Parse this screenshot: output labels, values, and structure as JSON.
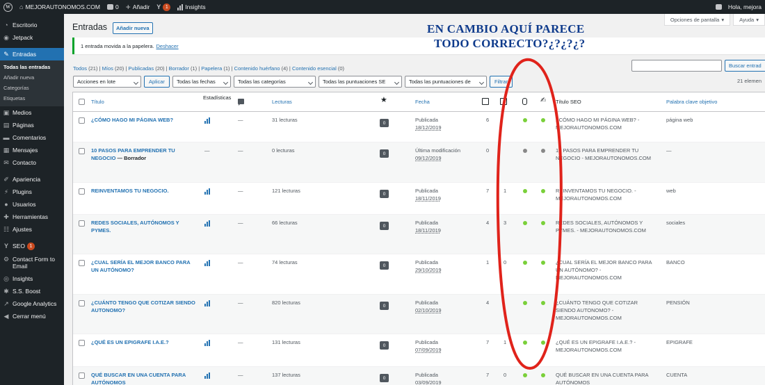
{
  "adminbar": {
    "site_name": "MEJORAUTONOMOS.COM",
    "comments_count": "0",
    "add_new": "Añadir",
    "updates_count": "1",
    "insights": "Insights",
    "greeting": "Hola, mejora"
  },
  "sidebar": {
    "items": [
      {
        "label": "Escritorio",
        "icon": "dashboard-icon"
      },
      {
        "label": "Jetpack",
        "icon": "jetpack-icon"
      },
      {
        "label": "Entradas",
        "icon": "pin-icon"
      },
      {
        "label": "Medios",
        "icon": "media-icon"
      },
      {
        "label": "Páginas",
        "icon": "pages-icon"
      },
      {
        "label": "Comentarios",
        "icon": "comments-icon"
      },
      {
        "label": "Mensajes",
        "icon": "messages-icon"
      },
      {
        "label": "Contacto",
        "icon": "mail-icon"
      },
      {
        "label": "Apariencia",
        "icon": "brush-icon"
      },
      {
        "label": "Plugins",
        "icon": "plugin-icon"
      },
      {
        "label": "Usuarios",
        "icon": "users-icon"
      },
      {
        "label": "Herramientas",
        "icon": "tools-icon"
      },
      {
        "label": "Ajustes",
        "icon": "settings-icon"
      },
      {
        "label": "SEO",
        "icon": "yoast-icon",
        "badge": "1"
      },
      {
        "label": "Contact Form to Email",
        "icon": "gear-icon"
      },
      {
        "label": "Insights",
        "icon": "insights-icon"
      },
      {
        "label": "S.S. Boost",
        "icon": "boost-icon"
      },
      {
        "label": "Google Analytics",
        "icon": "analytics-icon"
      },
      {
        "label": "Cerrar menú",
        "icon": "collapse-icon"
      }
    ],
    "submenu": [
      "Todas las entradas",
      "Añadir nueva",
      "Categorías",
      "Etiquetas"
    ]
  },
  "header": {
    "title": "Entradas",
    "add_new": "Añadir nueva",
    "screen_options": "Opciones de pantalla",
    "help": "Ayuda"
  },
  "notice": {
    "text": "1 entrada movida a la papelera.",
    "undo": "Deshacer"
  },
  "views": [
    {
      "label": "Todos",
      "count": "(21)"
    },
    {
      "label": "Míos",
      "count": "(20)"
    },
    {
      "label": "Publicadas",
      "count": "(20)"
    },
    {
      "label": "Borrador",
      "count": "(1)"
    },
    {
      "label": "Papelera",
      "count": "(1)"
    },
    {
      "label": "Contenido huérfano",
      "count": "(4)"
    },
    {
      "label": "Contenido esencial",
      "count": "(0)"
    }
  ],
  "search": {
    "button": "Buscar entrad"
  },
  "filters": {
    "bulk": "Acciones en lote",
    "apply": "Aplicar",
    "dates": "Todas las fechas",
    "categories": "Todas las categorías",
    "seo_scores": "Todas las puntuaciones SE",
    "readability": "Todas las puntuaciones de",
    "filter": "Filtrar",
    "items_count": "21 elemen"
  },
  "columns": {
    "title": "Título",
    "stats": "Estadísticas",
    "reads": "Lecturas",
    "date": "Fecha",
    "seo_title": "Título SEO",
    "focus_kw": "Palabra clave objetivo"
  },
  "rows": [
    {
      "title": "¿CÓMO HAGO MI PÁGINA WEB?",
      "suffix": "",
      "stats": true,
      "comments": "—",
      "reads": "31 lecturas",
      "score": "0",
      "status": "Publicada",
      "date": "18/12/2019",
      "links_out": "6",
      "links_in": "",
      "seo": "green",
      "read": "green",
      "seo_title": "¿CÓMO HAGO MI PÁGINA WEB? - MEJORAUTONOMOS.COM",
      "kw": "página web"
    },
    {
      "title": "10 PASOS PARA EMPRENDER TU NEGOCIO",
      "suffix": " — Borrador",
      "stats": false,
      "comments": "—",
      "reads": "0 lecturas",
      "score": "0",
      "status": "Última modificación",
      "date": "09/12/2019",
      "links_out": "0",
      "links_in": "",
      "seo": "gray",
      "read": "gray",
      "seo_title": "10 PASOS PARA EMPRENDER TU NEGOCIO - MEJORAUTONOMOS.COM",
      "kw": "—"
    },
    {
      "title": "REINVENTAMOS TU NEGOCIO.",
      "suffix": "",
      "stats": true,
      "comments": "—",
      "reads": "121 lecturas",
      "score": "0",
      "status": "Publicada",
      "date": "18/11/2019",
      "links_out": "7",
      "links_in": "1",
      "seo": "green",
      "read": "green",
      "seo_title": "REINVENTAMOS TU NEGOCIO. - MEJORAUTONOMOS.COM",
      "kw": "web"
    },
    {
      "title": "REDES SOCIALES, AUTÓNOMOS Y PYMES.",
      "suffix": "",
      "stats": true,
      "comments": "—",
      "reads": "66 lecturas",
      "score": "0",
      "status": "Publicada",
      "date": "18/11/2019",
      "links_out": "4",
      "links_in": "3",
      "seo": "green",
      "read": "green",
      "seo_title": "REDES SOCIALES, AUTÓNOMOS Y PYMES. - MEJORAUTONOMOS.COM",
      "kw": "sociales"
    },
    {
      "title": "¿CUAL SERÍA EL MEJOR BANCO PARA UN AUTÓNOMO?",
      "suffix": "",
      "stats": true,
      "comments": "—",
      "reads": "74 lecturas",
      "score": "0",
      "status": "Publicada",
      "date": "29/10/2019",
      "links_out": "1",
      "links_in": "0",
      "seo": "green",
      "read": "green",
      "seo_title": "¿CUAL SERÍA EL MEJOR BANCO PARA UN AUTÓNOMO? - MEJORAUTONOMOS.COM",
      "kw": "BANCO"
    },
    {
      "title": "¿CUÁNTO TENGO QUE COTIZAR SIENDO AUTONOMO?",
      "suffix": "",
      "stats": true,
      "comments": "—",
      "reads": "820 lecturas",
      "score": "0",
      "status": "Publicada",
      "date": "02/10/2019",
      "links_out": "4",
      "links_in": "",
      "seo": "green",
      "read": "green",
      "seo_title": "¿CUÁNTO TENGO QUE COTIZAR SIENDO AUTONOMO? - MEJORAUTONOMOS.COM",
      "kw": "PENSIÓN"
    },
    {
      "title": "¿QUÉ ES UN EPIGRAFE I.A.E.?",
      "suffix": "",
      "stats": true,
      "comments": "—",
      "reads": "131 lecturas",
      "score": "0",
      "status": "Publicada",
      "date": "07/09/2019",
      "links_out": "7",
      "links_in": "1",
      "seo": "green",
      "read": "green",
      "seo_title": "¿QUÉ ES UN EPIGRAFE I.A.E.? - MEJORAUTONOMOS.COM",
      "kw": "EPIGRAFE"
    },
    {
      "title": "QUÉ BUSCAR EN UNA CUENTA PARA AUTÓNOMOS",
      "suffix": "",
      "stats": true,
      "comments": "—",
      "reads": "137 lecturas",
      "score": "0",
      "status": "Publicada",
      "date": "03/09/2019",
      "links_out": "7",
      "links_in": "0",
      "seo": "green",
      "read": "green",
      "seo_title": "QUÉ BUSCAR EN UNA CUENTA PARA AUTÓNOMOS",
      "kw": "CUENTA"
    }
  ],
  "annotation": {
    "line1": "EN CAMBIO AQUÍ PARECE",
    "line2": "TODO CORRECTO?¿?¿?¿?",
    "color": "#0f3b8c",
    "ellipse_color": "#e0231b"
  }
}
